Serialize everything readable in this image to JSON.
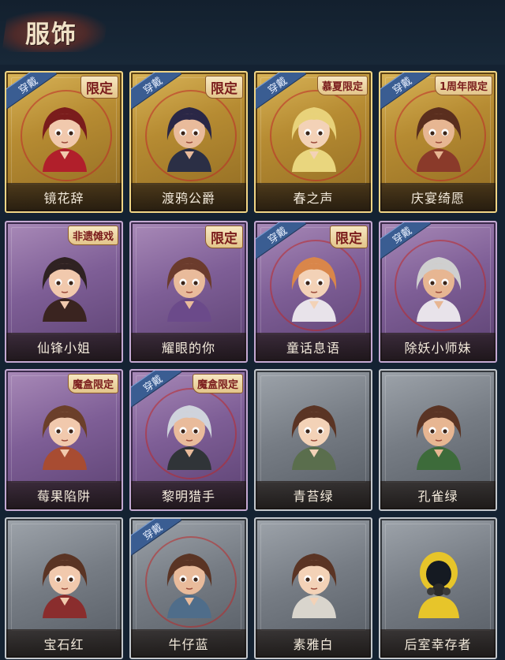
{
  "header": {
    "title": "服饰"
  },
  "colors": {
    "gold_frame": "#d9b458",
    "purple_frame": "#a98ab8",
    "gray_frame": "#9ea4ab",
    "worn_ribbon": "#3a5d92",
    "tag_text": "#7a1c1c"
  },
  "costumes": [
    {
      "name": "镜花辞",
      "tier": "gold",
      "tag": "限定",
      "worn": "穿戴"
    },
    {
      "name": "渡鸦公爵",
      "tier": "gold",
      "tag": "限定",
      "worn": "穿戴"
    },
    {
      "name": "春之声",
      "tier": "gold",
      "tag": "慕夏限定",
      "worn": "穿戴"
    },
    {
      "name": "庆宴绮愿",
      "tier": "gold",
      "tag": "1周年限定",
      "worn": "穿戴"
    },
    {
      "name": "仙锋小姐",
      "tier": "purple",
      "tag": "非遗傩戏",
      "worn": ""
    },
    {
      "name": "耀眼的你",
      "tier": "purple",
      "tag": "限定",
      "worn": ""
    },
    {
      "name": "童话息语",
      "tier": "purple",
      "tag": "限定",
      "worn": "穿戴"
    },
    {
      "name": "除妖小师妹",
      "tier": "purple",
      "tag": "",
      "worn": "穿戴"
    },
    {
      "name": "莓果陷阱",
      "tier": "purple",
      "tag": "魔盒限定",
      "worn": ""
    },
    {
      "name": "黎明猎手",
      "tier": "purple",
      "tag": "魔盒限定",
      "worn": "穿戴"
    },
    {
      "name": "青苔绿",
      "tier": "gray",
      "tag": "",
      "worn": ""
    },
    {
      "name": "孔雀绿",
      "tier": "gray",
      "tag": "",
      "worn": ""
    },
    {
      "name": "宝石红",
      "tier": "gray",
      "tag": "",
      "worn": ""
    },
    {
      "name": "牛仔蓝",
      "tier": "gray",
      "tag": "",
      "worn": "穿戴"
    },
    {
      "name": "素雅白",
      "tier": "gray",
      "tag": "",
      "worn": ""
    },
    {
      "name": "后室幸存者",
      "tier": "gray",
      "tag": "",
      "worn": ""
    }
  ]
}
